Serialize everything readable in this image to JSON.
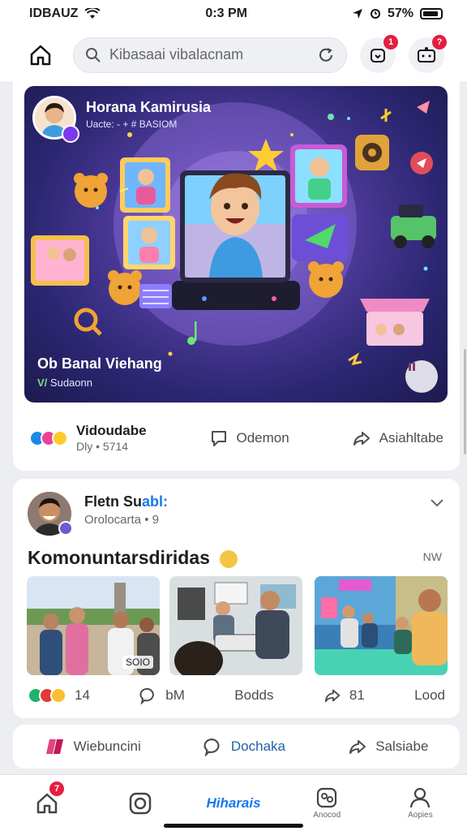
{
  "status": {
    "carrier": "IDBAUZ",
    "time": "0:3 PM",
    "battery": "57%"
  },
  "topbar": {
    "search_placeholder": "Kibasaai vibalacnam",
    "badge_left": "1",
    "badge_right": "?"
  },
  "feature_post": {
    "author": "Horana Kamirusia",
    "subtitle": "Uacte: - + # BASIOM",
    "caption": "Ob Banal Viehang",
    "meta": "Sudaonn",
    "reactions_label": "Vidoudabe",
    "reactions_count": "Dly • 5714",
    "comment_label": "Odemon",
    "share_label": "Asiahltabe"
  },
  "post2": {
    "author_prefix": "Fletn Su",
    "author_link": "abl:",
    "meta": "Orolocarta • 9",
    "text": "Komonuntarsdiridas",
    "tag": "NW",
    "thumb_label": "SOIO",
    "reaction_count": "14",
    "comment_count": "bM",
    "comment_label": "Bodds",
    "share_count": "81",
    "share_label": "Lood"
  },
  "action_bar": {
    "left": "Wiebuncini",
    "middle": "Dochaka",
    "right": "Salsiabe"
  },
  "nav": {
    "home_badge": "7",
    "active_label": "Hiharais",
    "item4": "Anocod",
    "item5": "Aopies"
  },
  "colors": {
    "accent": "#1877f2",
    "badge": "#e41e3f",
    "hero_bg": "#2b2670"
  },
  "icons": [
    "home-icon",
    "search-icon",
    "refresh-icon",
    "bell-icon",
    "message-icon",
    "comment-icon",
    "share-icon",
    "chevron-down-icon",
    "camera-icon",
    "group-icon",
    "profile-icon"
  ]
}
